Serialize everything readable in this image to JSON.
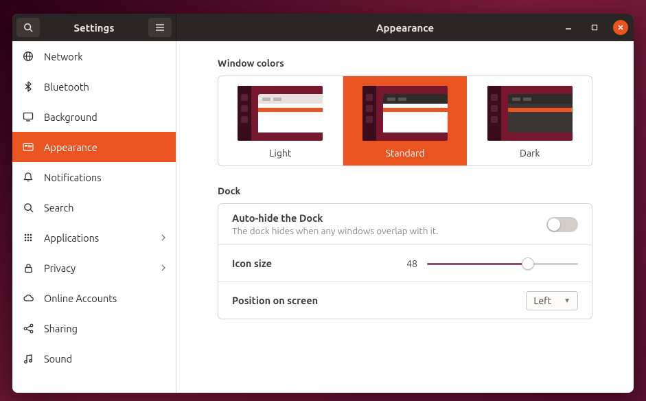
{
  "titlebar": {
    "sidebar_title": "Settings",
    "page_title": "Appearance"
  },
  "sidebar": {
    "items": [
      {
        "icon": "globe",
        "label": "Network",
        "chevron": false,
        "active": false
      },
      {
        "icon": "bluetooth",
        "label": "Bluetooth",
        "chevron": false,
        "active": false
      },
      {
        "icon": "display",
        "label": "Background",
        "chevron": false,
        "active": false
      },
      {
        "icon": "appearance",
        "label": "Appearance",
        "chevron": false,
        "active": true
      },
      {
        "icon": "bell",
        "label": "Notifications",
        "chevron": false,
        "active": false
      },
      {
        "icon": "search",
        "label": "Search",
        "chevron": false,
        "active": false
      },
      {
        "icon": "apps",
        "label": "Applications",
        "chevron": true,
        "active": false
      },
      {
        "icon": "lock",
        "label": "Privacy",
        "chevron": true,
        "active": false
      },
      {
        "icon": "cloud",
        "label": "Online Accounts",
        "chevron": false,
        "active": false
      },
      {
        "icon": "share",
        "label": "Sharing",
        "chevron": false,
        "active": false
      },
      {
        "icon": "music",
        "label": "Sound",
        "chevron": false,
        "active": false
      }
    ]
  },
  "appearance": {
    "window_colors_heading": "Window colors",
    "themes": [
      {
        "key": "light",
        "label": "Light",
        "selected": false
      },
      {
        "key": "standard",
        "label": "Standard",
        "selected": true
      },
      {
        "key": "dark",
        "label": "Dark",
        "selected": false
      }
    ],
    "dock_heading": "Dock",
    "autohide": {
      "label": "Auto-hide the Dock",
      "sublabel": "The dock hides when any windows overlap with it.",
      "value": false
    },
    "icon_size": {
      "label": "Icon size",
      "value": 48,
      "min": 16,
      "max": 64
    },
    "position": {
      "label": "Position on screen",
      "value": "Left"
    }
  }
}
